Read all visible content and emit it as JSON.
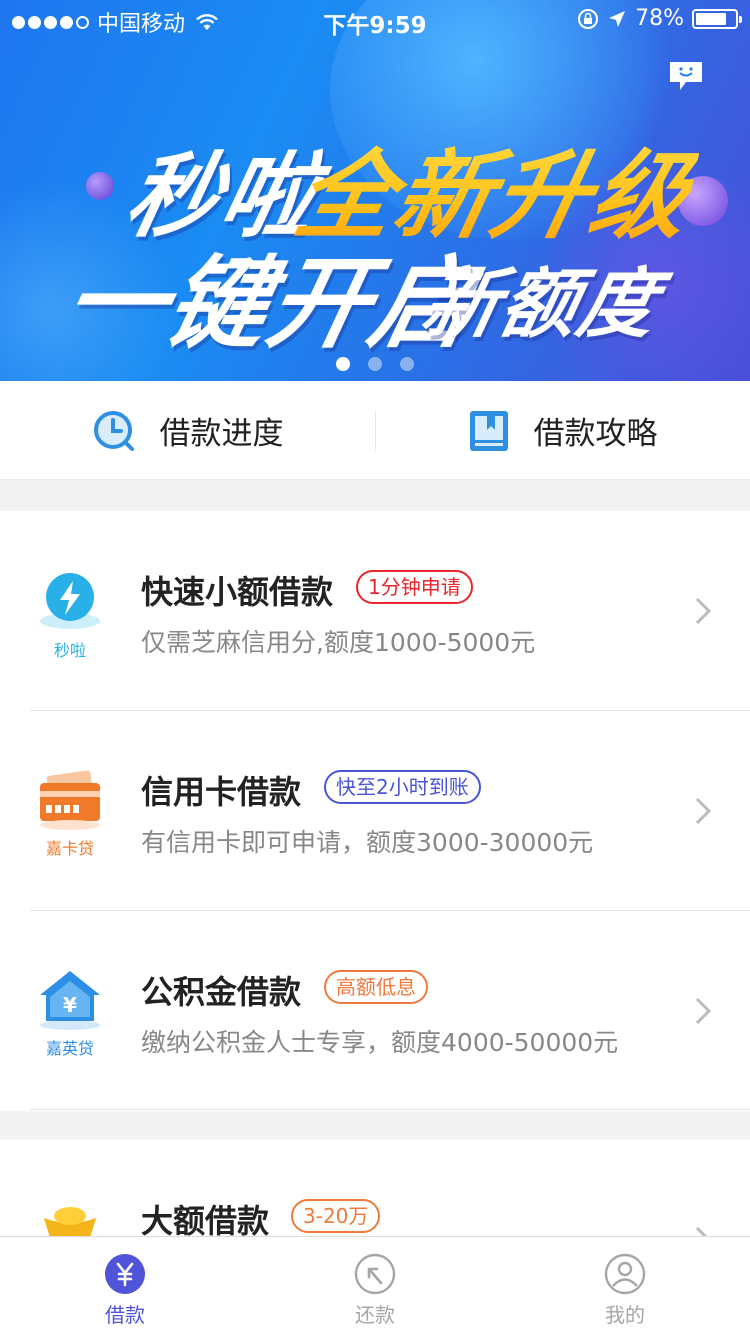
{
  "status_bar": {
    "carrier": "中国移动",
    "time": "下午9:59",
    "battery": "78%",
    "battery_level": 0.78
  },
  "banner": {
    "line1_white": "秒啦",
    "line1_yellow": "全新升级",
    "line2_big": "一键开启",
    "line2_small": "新额度",
    "pages": 3,
    "active_page": 0
  },
  "quick_links": [
    {
      "label": "借款进度",
      "icon": "clock-icon"
    },
    {
      "label": "借款攻略",
      "icon": "guide-book-icon"
    }
  ],
  "loans": [
    {
      "title": "快速小额借款",
      "tag": "1分钟申请",
      "tag_color": "#e8262b",
      "desc": "仅需芝麻信用分,额度1000-5000元",
      "logo_caption": "秒啦",
      "logo_color": "#2ab0e8",
      "icon": "lightning-icon"
    },
    {
      "title": "信用卡借款",
      "tag": "快至2小时到账",
      "tag_color": "#4a55d6",
      "desc": "有信用卡即可申请，额度3000-30000元",
      "logo_caption": "嘉卡贷",
      "logo_color": "#f07a2a",
      "icon": "credit-card-icon"
    },
    {
      "title": "公积金借款",
      "tag": "高额低息",
      "tag_color": "#f07a3c",
      "desc": "缴纳公积金人士专享，额度4000-50000元",
      "logo_caption": "嘉英贷",
      "logo_color": "#2d8ee6",
      "icon": "house-icon"
    },
    {
      "title": "大额借款",
      "tag": "3-20万",
      "tag_color": "#f07a3c",
      "desc": "",
      "logo_caption": "",
      "logo_color": "#f5b41a",
      "icon": "gold-ingot-icon"
    }
  ],
  "tabs": [
    {
      "label": "借款",
      "icon": "yuan-icon",
      "active": true
    },
    {
      "label": "还款",
      "icon": "repay-icon",
      "active": false
    },
    {
      "label": "我的",
      "icon": "profile-icon",
      "active": false
    }
  ],
  "colors": {
    "accent": "#5054d8",
    "tab_inactive": "#a6a6a6"
  }
}
